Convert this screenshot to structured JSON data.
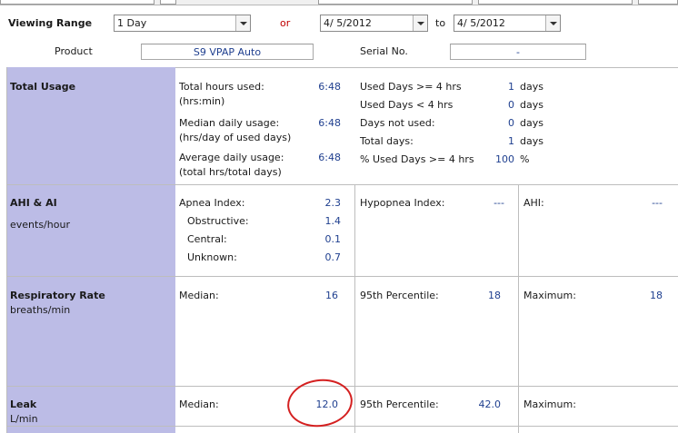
{
  "header": {
    "viewing_range_label": "Viewing Range",
    "viewing_range_value": "1 Day",
    "or_label": "or",
    "from_date": "4/  5/2012",
    "to_label": "to",
    "to_date": "4/  5/2012",
    "product_label": "Product",
    "product_value": "S9 VPAP Auto",
    "serial_label": "Serial No.",
    "serial_value": "-"
  },
  "total_usage": {
    "title": "Total Usage",
    "total_hours_label_1": "Total hours used:",
    "total_hours_label_2": "(hrs:min)",
    "total_hours_value": "6:48",
    "median_daily_label_1": "Median daily usage:",
    "median_daily_label_2": "(hrs/day of used days)",
    "median_daily_value": "6:48",
    "average_daily_label_1": "Average daily usage:",
    "average_daily_label_2": "(total hrs/total days)",
    "average_daily_value": "6:48",
    "used_ge4_label": "Used Days >= 4 hrs",
    "used_ge4_value": "1",
    "used_ge4_unit": "days",
    "used_lt4_label": "Used Days < 4 hrs",
    "used_lt4_value": "0",
    "used_lt4_unit": "days",
    "not_used_label": "Days not used:",
    "not_used_value": "0",
    "not_used_unit": "days",
    "total_days_label": "Total days:",
    "total_days_value": "1",
    "total_days_unit": "days",
    "pct_used_label": "% Used Days >= 4 hrs",
    "pct_used_value": "100",
    "pct_used_unit": "%"
  },
  "ahi": {
    "title": "AHI & AI",
    "unit": "events/hour",
    "apnea_label": "Apnea Index:",
    "apnea_value": "2.3",
    "obstructive_label": "Obstructive:",
    "obstructive_value": "1.4",
    "central_label": "Central:",
    "central_value": "0.1",
    "unknown_label": "Unknown:",
    "unknown_value": "0.7",
    "hypopnea_label": "Hypopnea Index:",
    "hypopnea_value": "---",
    "ahi_label": "AHI:",
    "ahi_value": "---"
  },
  "respiratory": {
    "title": "Respiratory Rate",
    "unit": "breaths/min",
    "median_label": "Median:",
    "median_value": "16",
    "p95_label": "95th Percentile:",
    "p95_value": "18",
    "max_label": "Maximum:",
    "max_value": "18"
  },
  "leak": {
    "title": "Leak",
    "unit": "L/min",
    "median_label": "Median:",
    "median_value": "12.0",
    "p95_label": "95th Percentile:",
    "p95_value": "42.0",
    "max_label": "Maximum:",
    "max_value": ""
  },
  "colors": {
    "sidebar": "#bcbce6",
    "value_text": "#1f3f8f",
    "or_text": "#c00000",
    "annotation_circle": "#d42020"
  }
}
